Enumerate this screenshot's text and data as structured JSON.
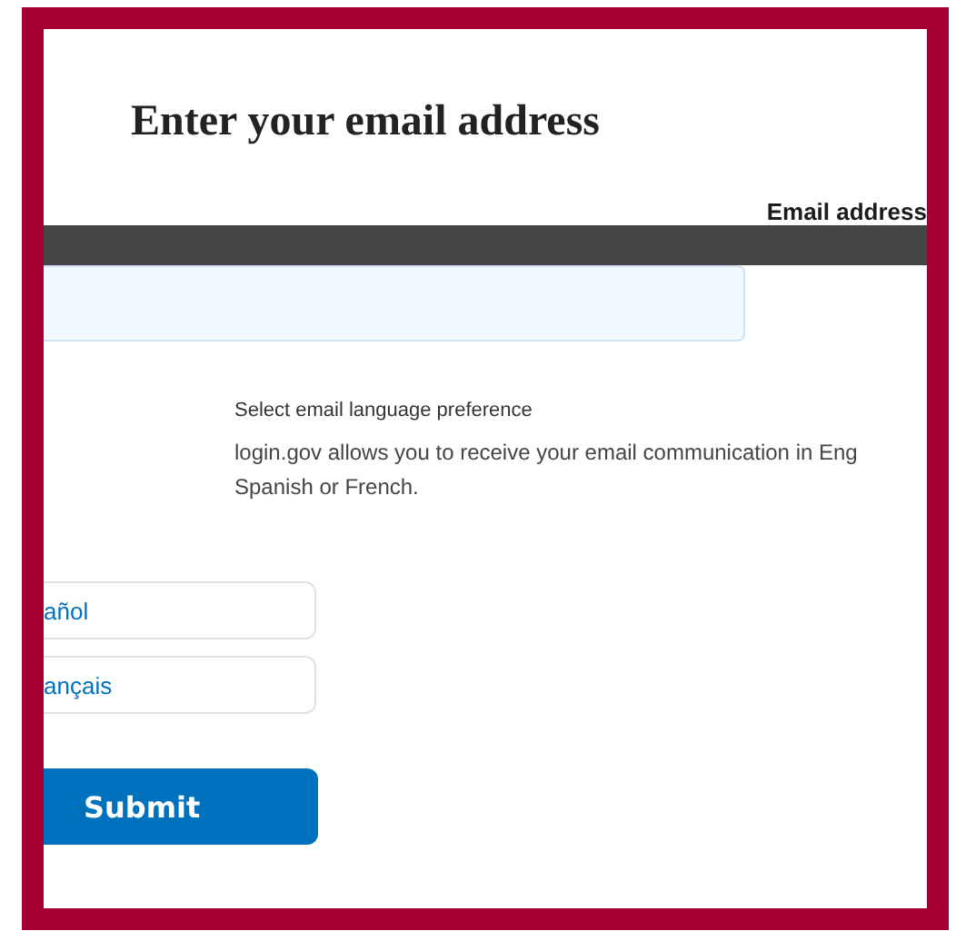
{
  "heading": "Enter your email address",
  "email_field": {
    "label": "Email address"
  },
  "language": {
    "legend": "Select email language preference",
    "description": "login.gov allows you to receive your email communication in Eng\nSpanish or French.",
    "options": [
      {
        "label": "añol",
        "selected": false
      },
      {
        "label": "ançais",
        "selected": false
      }
    ]
  },
  "submit": {
    "label": "Submit"
  }
}
